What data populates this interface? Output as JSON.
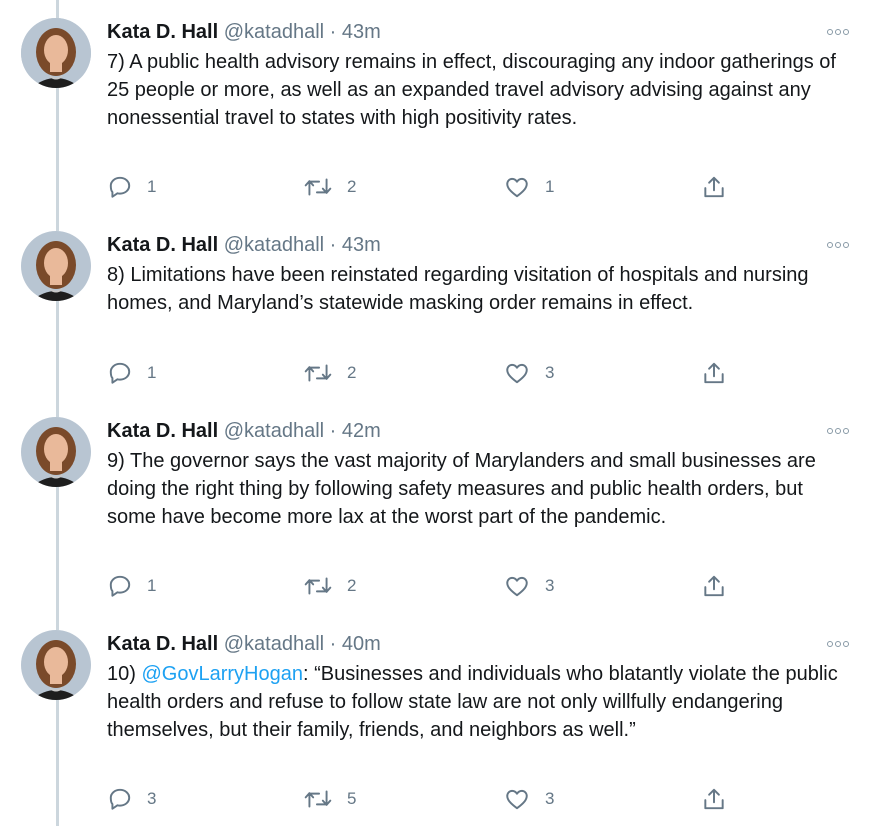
{
  "tweets": [
    {
      "author": "Kata D. Hall",
      "handle": "@katadhall",
      "separator": "·",
      "time": "43m",
      "text_pre": "7) A public health advisory remains in effect, discouraging any indoor gatherings of 25 people or more, as well as an expanded travel advisory advising against any nonessential travel to states with high positivity rates.",
      "mention": "",
      "text_post": "",
      "replies": "1",
      "retweets": "2",
      "likes": "1"
    },
    {
      "author": "Kata D. Hall",
      "handle": "@katadhall",
      "separator": "·",
      "time": "43m",
      "text_pre": "8) Limitations have been reinstated regarding visitation of hospitals and nursing homes, and Maryland’s statewide masking order remains in effect.",
      "mention": "",
      "text_post": "",
      "replies": "1",
      "retweets": "2",
      "likes": "3"
    },
    {
      "author": "Kata D. Hall",
      "handle": "@katadhall",
      "separator": "·",
      "time": "42m",
      "text_pre": "9) The governor says the vast majority of Marylanders and small businesses are doing the right thing by following safety measures and public health orders, but some have become more lax at the worst part of the pandemic.",
      "mention": "",
      "text_post": "",
      "replies": "1",
      "retweets": "2",
      "likes": "3"
    },
    {
      "author": "Kata D. Hall",
      "handle": "@katadhall",
      "separator": "·",
      "time": "40m",
      "text_pre": "10) ",
      "mention": "@GovLarryHogan",
      "text_post": ": “Businesses and individuals who blatantly violate the public health orders and refuse to follow state law are not only willfully endangering themselves, but their family, friends, and neighbors as well.”",
      "replies": "3",
      "retweets": "5",
      "likes": "3"
    }
  ],
  "colors": {
    "accent": "#1da1f2",
    "secondary_text": "#657786",
    "thread_line": "#ccd6dd"
  },
  "icons": [
    "reply-icon",
    "retweet-icon",
    "like-icon",
    "share-icon",
    "more-icon",
    "avatar"
  ]
}
